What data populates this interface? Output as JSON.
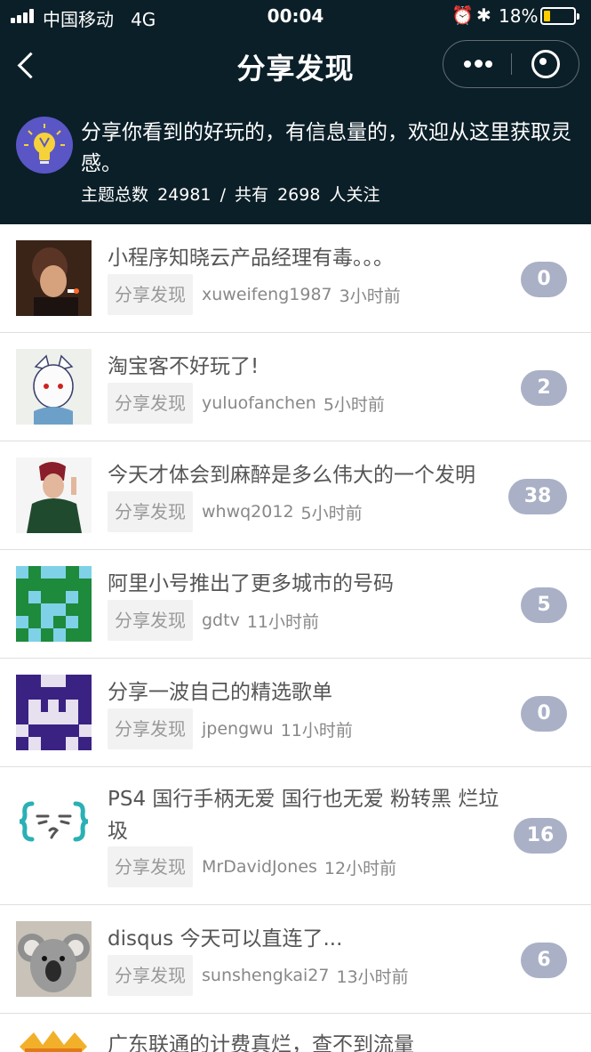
{
  "status_bar": {
    "carrier": "中国移动",
    "network": "4G",
    "time": "00:04",
    "battery": "18%"
  },
  "nav": {
    "title": "分享发现",
    "back_icon": "chevron-left-icon",
    "more_icon": "more-dots-icon",
    "close_icon": "target-circle-icon"
  },
  "topic": {
    "icon": "lightbulb-icon",
    "description": "分享你看到的好玩的，有信息量的，欢迎从这里获取灵感。",
    "stats": {
      "label_total": "主题总数",
      "total": "24981",
      "separator": "/",
      "label_followers": "共有",
      "followers": "2698",
      "followers_suffix": "人关注"
    }
  },
  "colors": {
    "header_bg": "#0b1f28",
    "count_badge": "#aab0c6",
    "tag_bg": "#f2f2f2"
  },
  "posts": [
    {
      "title": "小程序知晓云产品经理有毒。。。",
      "node": "分享发现",
      "author": "xuweifeng1987",
      "time": "3小时前",
      "replies": "0"
    },
    {
      "title": "淘宝客不好玩了!",
      "node": "分享发现",
      "author": "yuluofanchen",
      "time": "5小时前",
      "replies": "2"
    },
    {
      "title": "今天才体会到麻醉是多么伟大的一个发明",
      "node": "分享发现",
      "author": "whwq2012",
      "time": "5小时前",
      "replies": "38"
    },
    {
      "title": "阿里小号推出了更多城市的号码",
      "node": "分享发现",
      "author": "gdtv",
      "time": "11小时前",
      "replies": "5"
    },
    {
      "title": "分享一波自己的精选歌单",
      "node": "分享发现",
      "author": "jpengwu",
      "time": "11小时前",
      "replies": "0"
    },
    {
      "title": "PS4 国行手柄无爱 国行也无爱 粉转黑 烂垃圾",
      "node": "分享发现",
      "author": "MrDavidJones",
      "time": "12小时前",
      "replies": "16"
    },
    {
      "title": "disqus 今天可以直连了...",
      "node": "分享发现",
      "author": "sunshengkai27",
      "time": "13小时前",
      "replies": "6"
    },
    {
      "title": "广东联通的计费真烂，查不到流量",
      "node": "分享发现",
      "author": "",
      "time": "",
      "replies": ""
    }
  ]
}
